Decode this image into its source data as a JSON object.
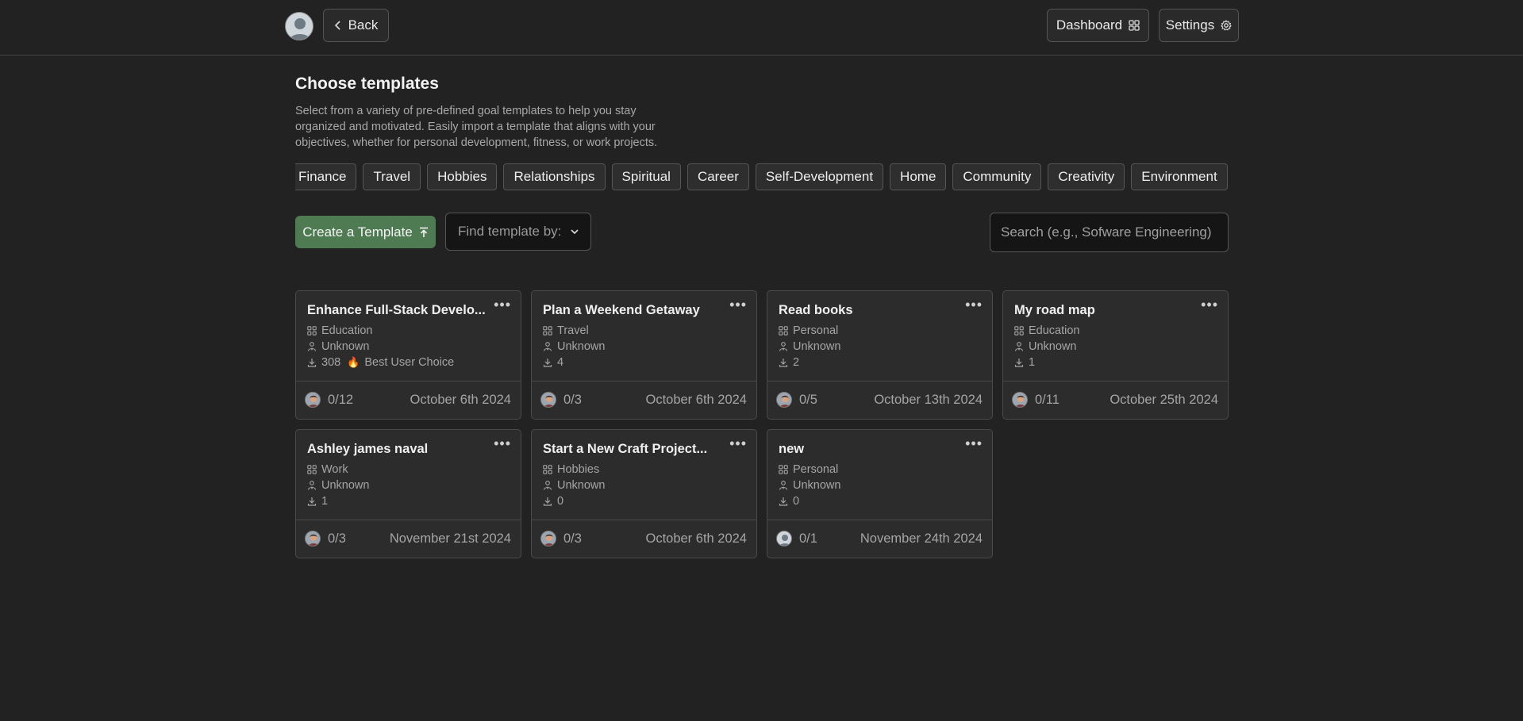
{
  "nav": {
    "back_label": "Back",
    "dashboard_label": "Dashboard",
    "settings_label": "Settings"
  },
  "header": {
    "title": "Choose templates",
    "description": "Select from a variety of pre-defined goal templates to help you stay organized and motivated. Easily import a template that aligns with your objectives, whether for personal development, fitness, or work projects."
  },
  "categories": [
    "Finance",
    "Travel",
    "Hobbies",
    "Relationships",
    "Spiritual",
    "Career",
    "Self-Development",
    "Home",
    "Community",
    "Creativity",
    "Environment"
  ],
  "controls": {
    "create_label": "Create a Template",
    "find_placeholder": "Find template by:",
    "search_placeholder": "Search (e.g., Sofware Engineering)"
  },
  "cards": [
    {
      "title": "Enhance Full-Stack Develo...",
      "category": "Education",
      "author": "Unknown",
      "downloads": "308",
      "badge": "Best User Choice",
      "progress": "0/12",
      "date": "October 6th 2024"
    },
    {
      "title": "Plan a Weekend Getaway",
      "category": "Travel",
      "author": "Unknown",
      "downloads": "4",
      "progress": "0/3",
      "date": "October 6th 2024"
    },
    {
      "title": "Read books",
      "category": "Personal",
      "author": "Unknown",
      "downloads": "2",
      "progress": "0/5",
      "date": "October 13th 2024"
    },
    {
      "title": "My road map",
      "category": "Education",
      "author": "Unknown",
      "downloads": "1",
      "progress": "0/11",
      "date": "October 25th 2024"
    },
    {
      "title": "Ashley james naval",
      "category": "Work",
      "author": "Unknown",
      "downloads": "1",
      "progress": "0/3",
      "date": "November 21st 2024"
    },
    {
      "title": "Start a New Craft Project...",
      "category": "Hobbies",
      "author": "Unknown",
      "downloads": "0",
      "progress": "0/3",
      "date": "October 6th 2024"
    },
    {
      "title": "new",
      "category": "Personal",
      "author": "Unknown",
      "downloads": "0",
      "progress": "0/1",
      "date": "November 24th 2024"
    }
  ],
  "colors": {
    "background": "#222222",
    "card": "#2c2c2c",
    "accent_green": "#4f7b52"
  },
  "icons": {
    "category": "grid-icon",
    "author": "user-tie-icon",
    "downloads": "download-icon",
    "badge": "flame-icon",
    "menu": "more-horizontal-icon"
  }
}
